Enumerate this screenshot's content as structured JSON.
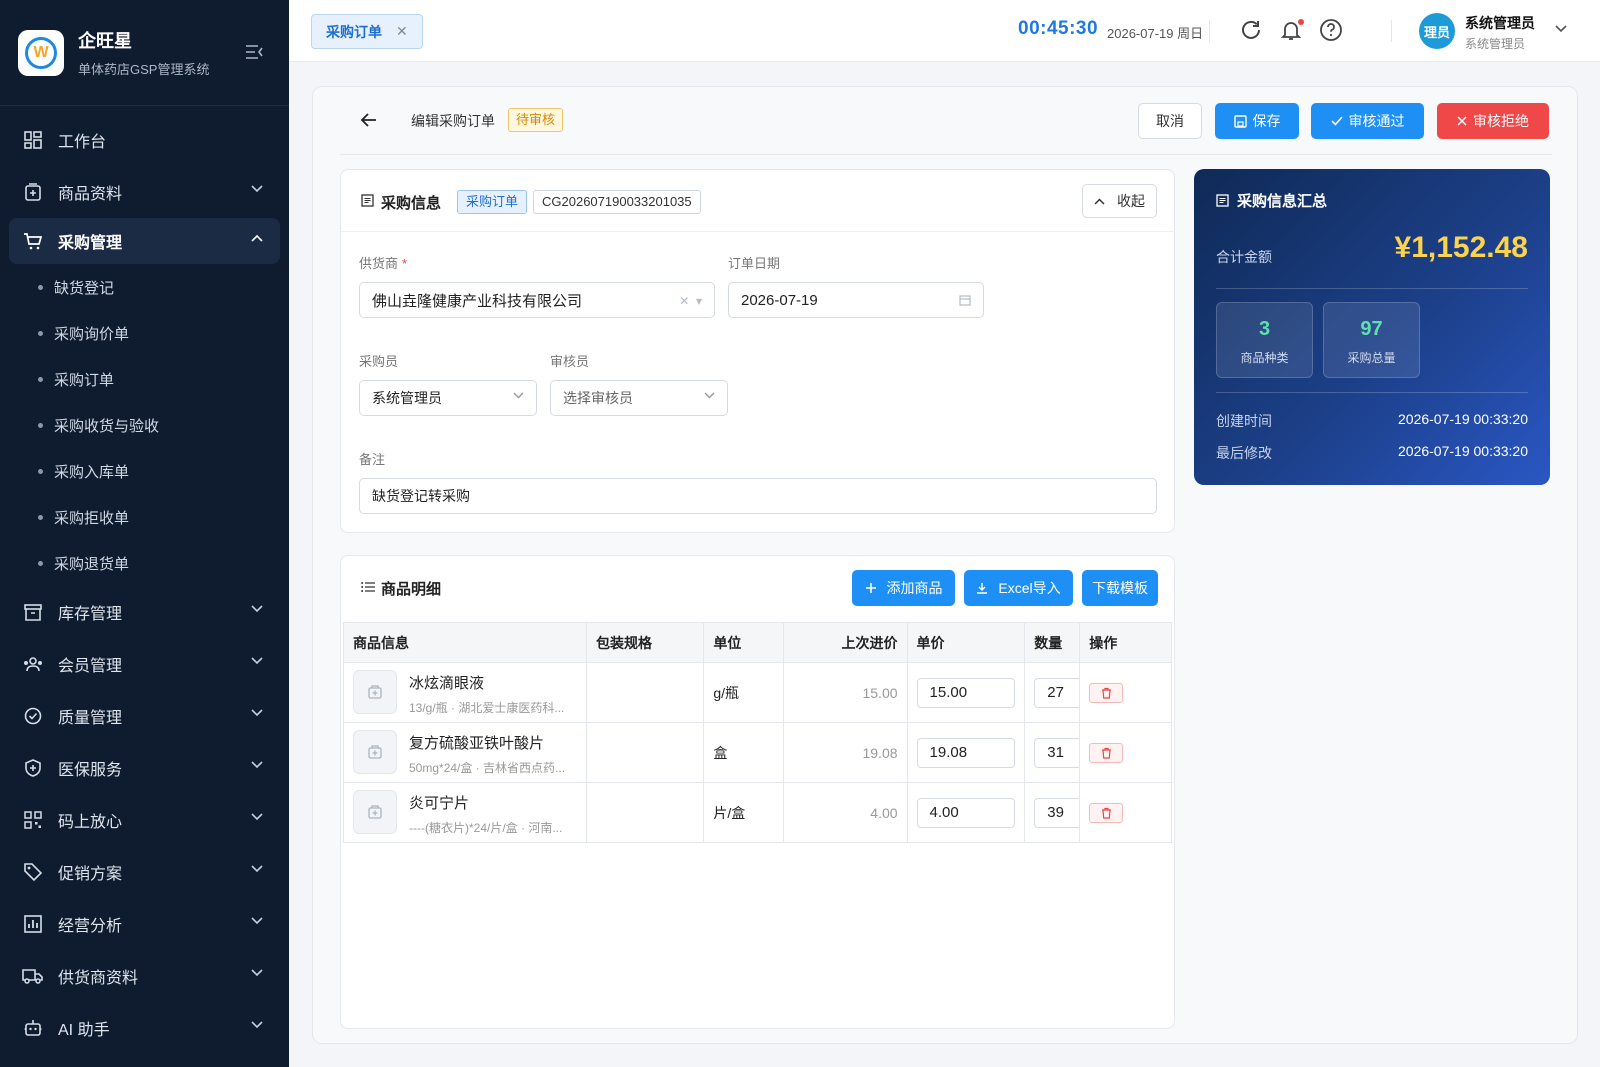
{
  "app": {
    "title": "企旺星",
    "subtitle": "单体药店GSP管理系统"
  },
  "sidebar": {
    "items": [
      {
        "label": "工作台",
        "icon": "dashboard-icon"
      },
      {
        "label": "商品资料",
        "icon": "product-icon"
      },
      {
        "label": "采购管理",
        "icon": "cart-icon"
      },
      {
        "label": "库存管理",
        "icon": "inventory-icon"
      },
      {
        "label": "会员管理",
        "icon": "members-icon"
      },
      {
        "label": "质量管理",
        "icon": "quality-icon"
      },
      {
        "label": "医保服务",
        "icon": "shield-icon"
      },
      {
        "label": "码上放心",
        "icon": "qrcode-icon"
      },
      {
        "label": "促销方案",
        "icon": "tag-icon"
      },
      {
        "label": "经营分析",
        "icon": "chart-icon"
      },
      {
        "label": "供货商资料",
        "icon": "truck-icon"
      },
      {
        "label": "AI 助手",
        "icon": "robot-icon"
      }
    ],
    "sub_items": [
      "缺货登记",
      "采购询价单",
      "采购订单",
      "采购收货与验收",
      "采购入库单",
      "采购拒收单",
      "采购退货单"
    ]
  },
  "topbar": {
    "tab_label": "采购订单",
    "clock": "00:45:30",
    "date": "2026-07-19 周日",
    "avatar_text": "理员",
    "user_name": "系统管理员",
    "user_role": "系统管理员"
  },
  "page": {
    "title": "编辑采购订单",
    "status": "待审核",
    "buttons": {
      "cancel": "取消",
      "save": "保存",
      "approve": "审核通过",
      "reject": "审核拒绝"
    }
  },
  "info": {
    "title": "采购信息",
    "tag": "采购订单",
    "order_no": "CG202607190033201035",
    "collapse": "收起",
    "supplier_label": "供货商",
    "supplier": "佛山垚隆健康产业科技有限公司",
    "date_label": "订单日期",
    "date": "2026-07-19",
    "buyer_label": "采购员",
    "buyer": "系统管理员",
    "reviewer_label": "审核员",
    "reviewer_placeholder": "选择审核员",
    "remark_label": "备注",
    "remark": "缺货登记转采购"
  },
  "summary": {
    "title": "采购信息汇总",
    "total_label": "合计金额",
    "total": "¥1,152.48",
    "kinds": "3",
    "kinds_label": "商品种类",
    "qty": "97",
    "qty_label": "采购总量",
    "created_label": "创建时间",
    "created": "2026-07-19 00:33:20",
    "modified_label": "最后修改",
    "modified": "2026-07-19 00:33:20"
  },
  "detail": {
    "title": "商品明细",
    "add": "添加商品",
    "import": "Excel导入",
    "template": "下载模板",
    "columns": [
      "商品信息",
      "包装规格",
      "单位",
      "上次进价",
      "单价",
      "数量",
      "操作"
    ],
    "rows": [
      {
        "name": "冰炫滴眼液",
        "desc": "13/g/瓶 · 湖北爱士康医药科...",
        "spec": "",
        "unit": "g/瓶",
        "last_price": "15.00",
        "price": "15.00",
        "qty": "27"
      },
      {
        "name": "复方硫酸亚铁叶酸片",
        "desc": "50mg*24/盒 · 吉林省西点药...",
        "spec": "",
        "unit": "盒",
        "last_price": "19.08",
        "price": "19.08",
        "qty": "31"
      },
      {
        "name": "炎可宁片",
        "desc": "----(糖衣片)*24/片/盒 · 河南...",
        "spec": "",
        "unit": "片/盒",
        "last_price": "4.00",
        "price": "4.00",
        "qty": "39"
      }
    ]
  },
  "colors": {
    "accent": "#1e90f5",
    "danger": "#f04848",
    "sidebar": "#0f1b2e",
    "total": "#fcd34d"
  }
}
